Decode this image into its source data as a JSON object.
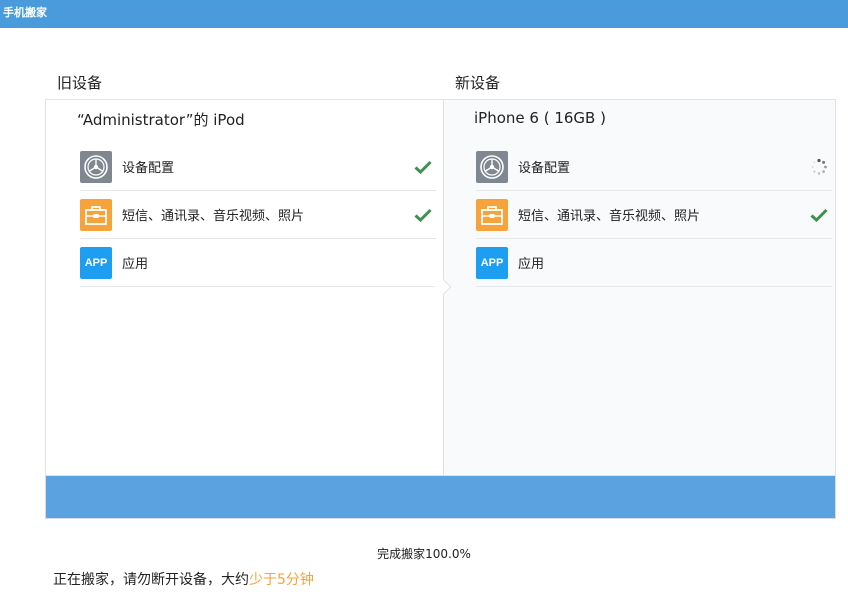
{
  "window": {
    "title": "手机搬家"
  },
  "old_device": {
    "heading": "旧设备",
    "name": "“Administrator”的 iPod",
    "items": [
      {
        "icon": "gear-icon",
        "label": "设备配置",
        "status": "done"
      },
      {
        "icon": "briefcase-icon",
        "label": "短信、通讯录、音乐视频、照片",
        "status": "done"
      },
      {
        "icon": "app-icon",
        "icon_text": "APP",
        "label": "应用",
        "status": "none"
      }
    ]
  },
  "new_device": {
    "heading": "新设备",
    "name": "iPhone 6 ( 16GB )",
    "items": [
      {
        "icon": "gear-icon",
        "label": "设备配置",
        "status": "loading"
      },
      {
        "icon": "briefcase-icon",
        "label": "短信、通讯录、音乐视频、照片",
        "status": "done"
      },
      {
        "icon": "app-icon",
        "icon_text": "APP",
        "label": "应用",
        "status": "none"
      }
    ]
  },
  "progress": {
    "percent": 100,
    "text": "完成搬家100.0%"
  },
  "footer": {
    "message": "正在搬家，请勿断开设备，大约",
    "eta": "少于5分钟"
  },
  "colors": {
    "titlebar": "#4a9bdc",
    "progress_fill": "#5aa3e0",
    "check": "#3f8f4f",
    "highlight": "#f5a33a"
  }
}
